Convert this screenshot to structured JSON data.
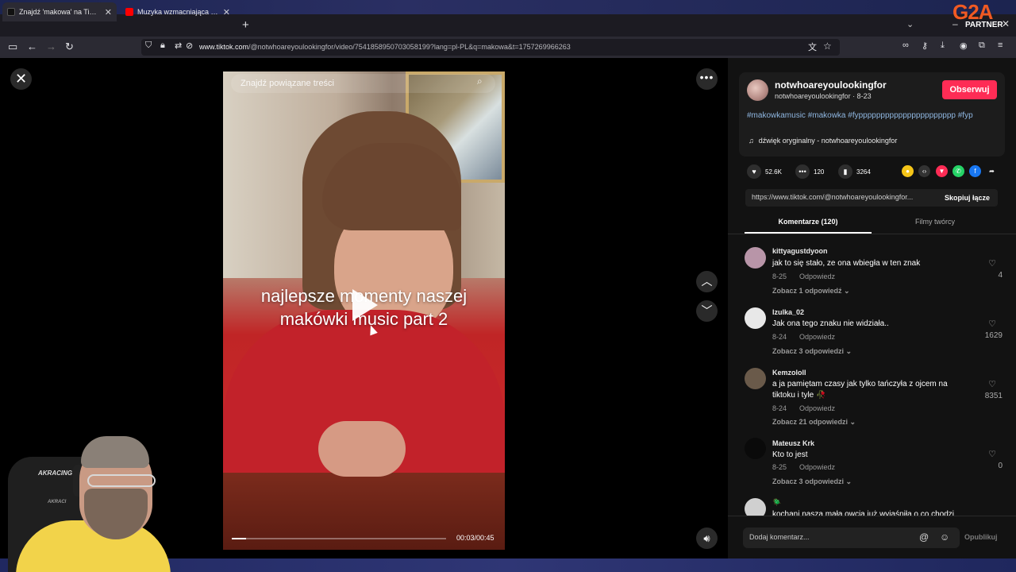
{
  "browser": {
    "tabs": [
      {
        "title": "Znajdź 'makowa' na TikTok | Wy",
        "active": true,
        "favicon_color": "#111111"
      },
      {
        "title": "Muzyka wzmacniająca i oczyszcza",
        "active": false,
        "favicon_color": "#ff0000"
      }
    ],
    "new_tab_icon": "plus-icon",
    "url_host": "www.tiktok.com",
    "url_path": "/@notwhoareyoulookingfor/video/7541858950703058199?lang=pl-PL&q=makowa&t=1757269966263"
  },
  "overlay_brand": {
    "logo": "G2A",
    "partner": "PARTNER",
    "accent": "#f15a22"
  },
  "video": {
    "search_placeholder": "Znajdź powiązane treści",
    "caption_line1": "najlepsze momenty naszej",
    "caption_line2": "makówki music part 2",
    "time": "00:03/00:45",
    "progress_fraction": 0.067
  },
  "webcam": {
    "brand": "AKRACING",
    "brand2": "AKRACI"
  },
  "author": {
    "username": "notwhoareyoulookingfor",
    "meta": "notwhoareyoulookingfor · 8-23",
    "follow_label": "Obserwuj",
    "hashtags": "#makowkamusic #makowka #fypppppppppppppppppppppp #fyp",
    "sound": "dźwięk oryginalny - notwhoareyoulookingfor"
  },
  "stats": {
    "likes": "52.6K",
    "comments": "120",
    "saves": "3264"
  },
  "link": {
    "url": "https://www.tiktok.com/@notwhoareyoulookingfor...",
    "copy_label": "Skopiuj łącze"
  },
  "panel_tabs": {
    "comments": "Komentarze (120)",
    "creator_videos": "Filmy twórcy"
  },
  "comments": [
    {
      "user": "kittyagustdyoon",
      "text": "jak to się stało, ze ona wbiegła w ten znak",
      "date": "8-25",
      "reply": "Odpowiedz",
      "more": "Zobacz 1 odpowiedź ⌄",
      "likes": "4",
      "avatar_color": "#b895a8"
    },
    {
      "user": "Izulka_02",
      "text": "Jak ona tego znaku nie widziała..",
      "date": "8-24",
      "reply": "Odpowiedz",
      "more": "Zobacz 3 odpowiedzi ⌄",
      "likes": "1629",
      "avatar_color": "#e8e8e8"
    },
    {
      "user": "Kemzololl",
      "text": "a ja pamiętam czasy jak tylko tańczyła z ojcem na tiktoku i tyle 🥀",
      "date": "8-24",
      "reply": "Odpowiedz",
      "more": "Zobacz 21 odpowiedzi ⌄",
      "likes": "8351",
      "avatar_color": "#6a5a4a"
    },
    {
      "user": "Mateusz Krk",
      "text": "Kto to jest",
      "date": "8-25",
      "reply": "Odpowiedz",
      "more": "Zobacz 3 odpowiedzi ⌄",
      "likes": "0",
      "avatar_color": "#0a0a0a"
    },
    {
      "user": "🪲",
      "text": "kochani nasza mała owcja już wyjaśniła o co chodzi",
      "avatar_color": "#d0d0d0"
    }
  ],
  "comment_input": {
    "placeholder": "Dodaj komentarz...",
    "publish_label": "Opublikuj"
  }
}
